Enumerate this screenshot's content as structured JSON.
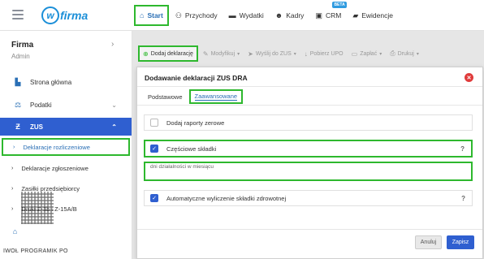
{
  "app": {
    "logo_text": "firma",
    "logo_letter": "w"
  },
  "nav": {
    "items": [
      {
        "label": "Start",
        "icon": "home-icon"
      },
      {
        "label": "Przychody",
        "icon": "person-icon"
      },
      {
        "label": "Wydatki",
        "icon": "wallet-icon"
      },
      {
        "label": "Kadry",
        "icon": "users-icon"
      },
      {
        "label": "CRM",
        "icon": "crm-icon",
        "badge": "BETA"
      },
      {
        "label": "Ewidencje",
        "icon": "folder-icon"
      }
    ]
  },
  "sidebar": {
    "company": "Firma",
    "role": "Admin",
    "items": [
      {
        "label": "Strona główna"
      },
      {
        "label": "Podatki"
      },
      {
        "label": "ZUS"
      }
    ],
    "sub_items": [
      {
        "label": "Deklaracje rozliczeniowe"
      },
      {
        "label": "Deklaracje zgłoszeniowe"
      },
      {
        "label": "Zasiłki przedsiębiorcy"
      },
      {
        "label": "Druki Z-3b i Z-15A/B"
      }
    ],
    "footer_text": "IWOŁ PROGRAMIK PO"
  },
  "toolbar": {
    "add": "Dodaj deklarację",
    "modify": "Modyfikuj",
    "send": "Wyślij do ZUS",
    "download": "Pobierz UPO",
    "pay": "Zapłać",
    "print": "Drukuj"
  },
  "modal": {
    "title": "Dodawanie deklaracji ZUS DRA",
    "tabs": {
      "basic": "Podstawowe",
      "advanced": "Zaawansowane"
    },
    "zero_reports": {
      "label": "Dodaj raporty zerowe",
      "checked": false
    },
    "partial": {
      "label": "Częściowe składki",
      "checked": true,
      "help": "?"
    },
    "days_field": {
      "label": "dni działalności w miesiącu",
      "value": ""
    },
    "auto_calc": {
      "label": "Automatyczne wyliczenie składki zdrowotnej",
      "checked": true,
      "help": "?"
    },
    "cancel": "Anuluj",
    "save": "Zapisz"
  },
  "colors": {
    "accent": "#2f5fd0",
    "highlight": "#2eb82e",
    "close": "#e03b3b"
  }
}
